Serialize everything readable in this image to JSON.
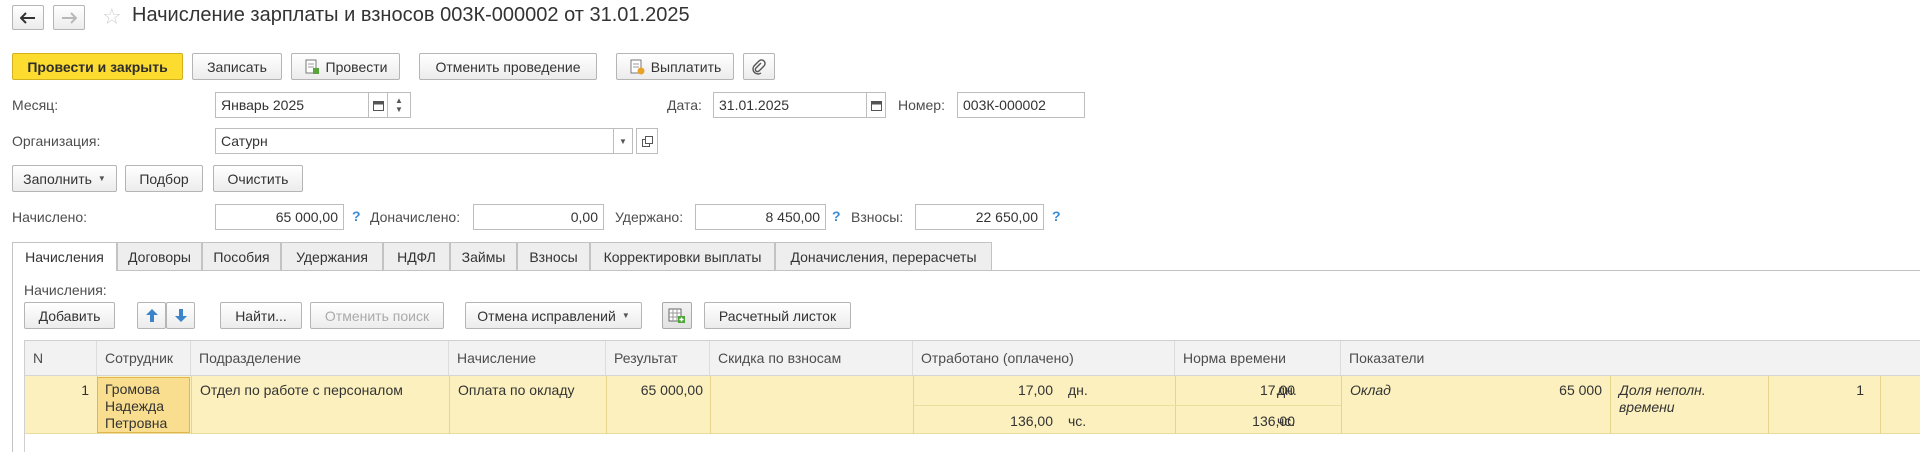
{
  "header": {
    "title": "Начисление зарплаты и взносов 003К-000002 от 31.01.2025"
  },
  "toolbar": {
    "post_close": "Провести и закрыть",
    "save": "Записать",
    "post": "Провести",
    "cancel_post": "Отменить проведение",
    "pay": "Выплатить"
  },
  "form": {
    "month_label": "Месяц:",
    "month_value": "Январь 2025",
    "date_label": "Дата:",
    "date_value": "31.01.2025",
    "number_label": "Номер:",
    "number_value": "003К-000002",
    "org_label": "Организация:",
    "org_value": "Сатурн"
  },
  "actions": {
    "fill": "Заполнить",
    "select": "Подбор",
    "clear": "Очистить"
  },
  "totals": {
    "accrued_label": "Начислено:",
    "accrued_value": "65 000,00",
    "additional_label": "Доначислено:",
    "additional_value": "0,00",
    "withheld_label": "Удержано:",
    "withheld_value": "8 450,00",
    "contrib_label": "Взносы:",
    "contrib_value": "22 650,00",
    "help": "?"
  },
  "tabs": [
    {
      "label": "Начисления"
    },
    {
      "label": "Договоры"
    },
    {
      "label": "Пособия"
    },
    {
      "label": "Удержания"
    },
    {
      "label": "НДФЛ"
    },
    {
      "label": "Займы"
    },
    {
      "label": "Взносы"
    },
    {
      "label": "Корректировки выплаты"
    },
    {
      "label": "Доначисления, перерасчеты"
    }
  ],
  "accruals": {
    "section_label": "Начисления:",
    "add": "Добавить",
    "find": "Найти...",
    "cancel_search": "Отменить поиск",
    "undo_corrections": "Отмена исправлений",
    "payslip": "Расчетный листок",
    "columns": {
      "n": "N",
      "employee": "Сотрудник",
      "department": "Подразделение",
      "accrual": "Начисление",
      "result": "Результат",
      "discount": "Скидка по взносам",
      "worked": "Отработано (оплачено)",
      "norm": "Норма времени",
      "indicators": "Показатели"
    },
    "rows": [
      {
        "n": "1",
        "employee_l1": "Громова",
        "employee_l2": "Надежда",
        "employee_l3": "Петровна",
        "department": "Отдел по работе с персоналом",
        "accrual": "Оплата по окладу",
        "result": "65 000,00",
        "discount": "",
        "worked_days": "17,00",
        "worked_days_unit": "дн.",
        "worked_hours": "136,00",
        "worked_hours_unit": "чс.",
        "norm_days": "17,00",
        "norm_days_unit": "дн.",
        "norm_hours": "136,00",
        "norm_hours_unit": "чс.",
        "ind1_name": "Оклад",
        "ind1_value": "65 000",
        "ind2_name_l1": "Доля неполн.",
        "ind2_name_l2": "времени",
        "ind2_value": "1"
      }
    ]
  }
}
